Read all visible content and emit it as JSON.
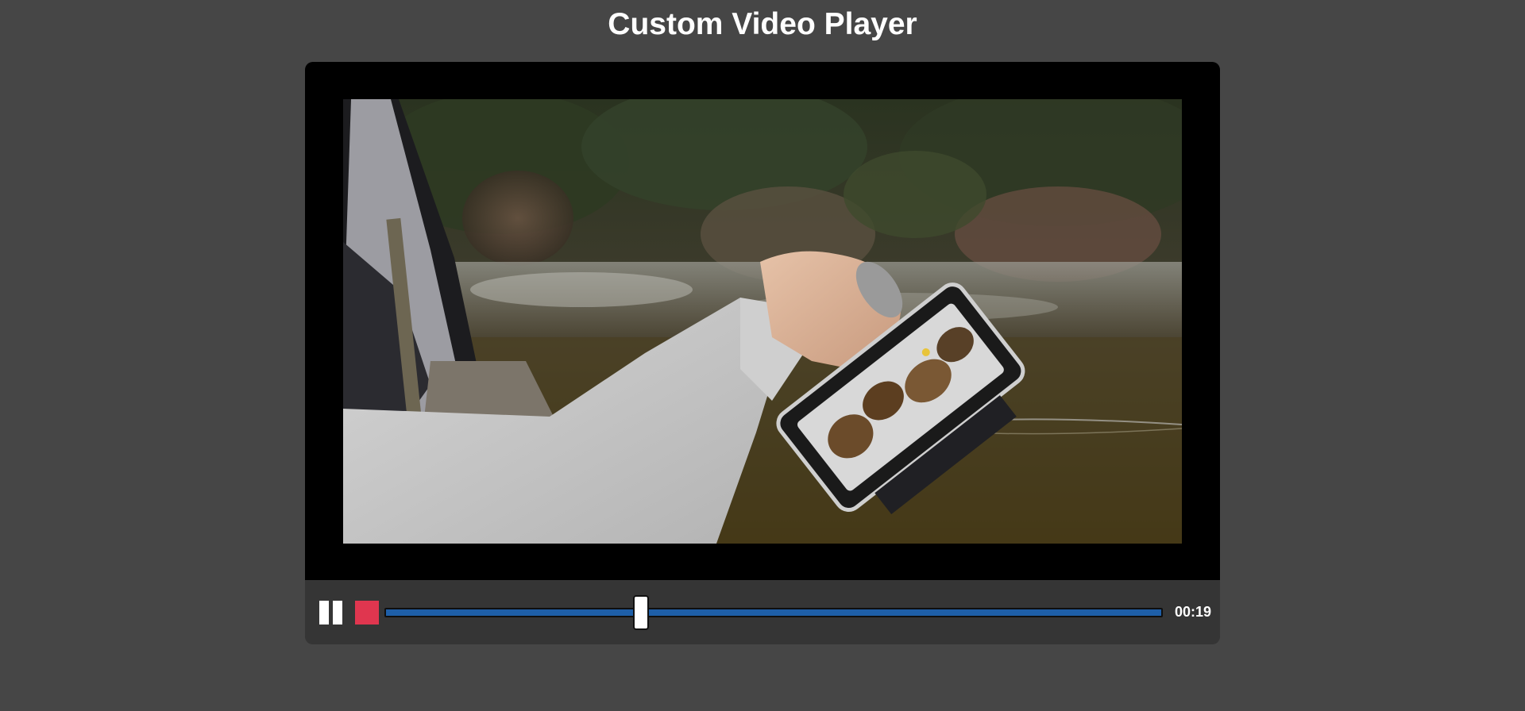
{
  "page": {
    "title": "Custom Video Player"
  },
  "controls": {
    "time": "00:19",
    "progress_fraction": 0.33,
    "pause_icon": "pause-icon",
    "stop_icon": "stop-icon",
    "stop_color": "#e0364f",
    "track_color": "#1e5fa8"
  }
}
